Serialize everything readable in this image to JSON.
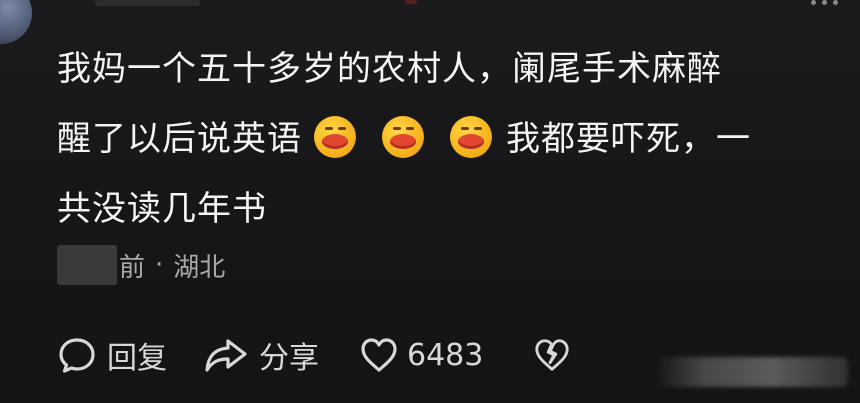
{
  "comment": {
    "line1": "我妈一个五十多岁的农村人，阑尾手术麻醉",
    "line2_start": "醒了以后说英语",
    "line2_end": "我都要吓死，一",
    "line3": "共没读几年书",
    "emoji_name": "kiss-emoji",
    "emoji_count": 3
  },
  "meta": {
    "time_suffix": "前",
    "separator": "·",
    "location": "湖北"
  },
  "actions": {
    "reply_label": "回复",
    "share_label": "分享",
    "like_count": "6483"
  },
  "icons": {
    "reply": "chat-bubble-icon",
    "share": "share-arrow-icon",
    "like": "heart-icon",
    "dislike": "broken-heart-icon"
  }
}
